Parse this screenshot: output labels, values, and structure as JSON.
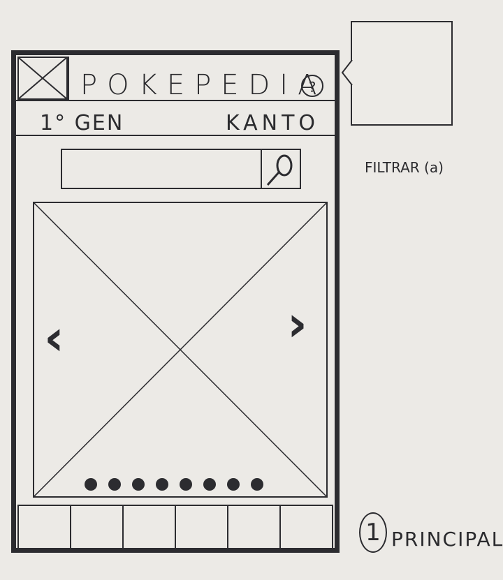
{
  "app": {
    "title": "POKEPEDIA",
    "help_icon": "?"
  },
  "header": {
    "generation": "1° GEN",
    "region": "KANTO"
  },
  "search": {
    "placeholder": "",
    "icon": "search-icon"
  },
  "carousel": {
    "prev_icon": "‹",
    "next_icon": "›",
    "dot_count": 8
  },
  "tabbar": {
    "tab_count": 6
  },
  "annotations": {
    "filter_label": "FILTRAR (a)",
    "screen_number": "1",
    "screen_name": "PRINCIPAL"
  }
}
